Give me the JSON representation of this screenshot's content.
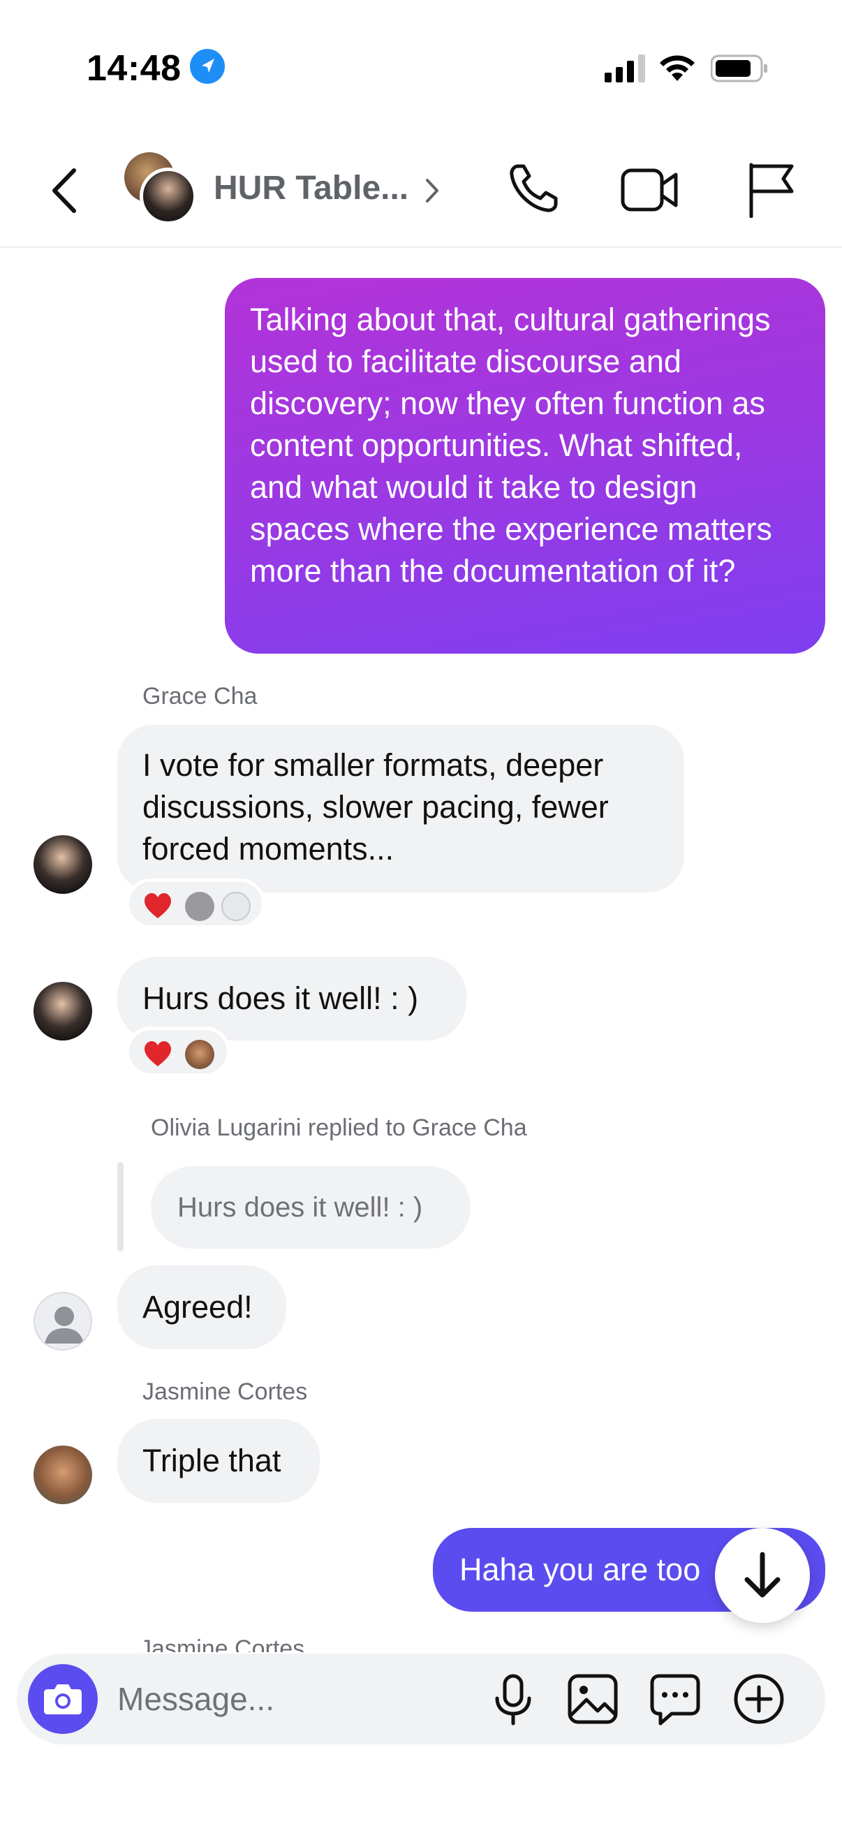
{
  "status_bar": {
    "time": "14:48"
  },
  "header": {
    "title": "HUR Table..."
  },
  "messages": {
    "m1_text": "Talking about that, cultural gatherings used to facilitate discourse and discovery; now they often function as content opportunities. What shifted, and what would it take to design spaces where the experience matters more than the documentation of it?",
    "m2_sender": "Grace Cha",
    "m2_text": "I vote for smaller formats, deeper discussions, slower pacing, fewer forced moments...",
    "m3_text": "Hurs does it well! : )",
    "reply_note": "Olivia Lugarini replied to Grace Cha",
    "reply_quote": "Hurs does it well! : )",
    "m4_text": "Agreed!",
    "m5_sender": "Jasmine Cortes",
    "m5_text": "Triple that",
    "m6_text": "Haha you are too",
    "next_sender": "Jasmine Cortes"
  },
  "composer": {
    "placeholder": "Message..."
  },
  "colors": {
    "accent_blue": "#5b4cf0",
    "outgoing_gradient_start": "#b233d8",
    "outgoing_gradient_end": "#7e3ef0",
    "incoming_bubble": "#f1f2f4",
    "heart": "#e0262b"
  },
  "icons": [
    "location-arrow-icon",
    "signal-icon",
    "wifi-icon",
    "battery-icon",
    "back-chevron-icon",
    "chevron-right-icon",
    "phone-icon",
    "video-camera-icon",
    "flag-icon",
    "heart-icon",
    "arrow-down-icon",
    "camera-icon",
    "microphone-icon",
    "image-icon",
    "chat-bubble-icon",
    "plus-circle-icon"
  ]
}
